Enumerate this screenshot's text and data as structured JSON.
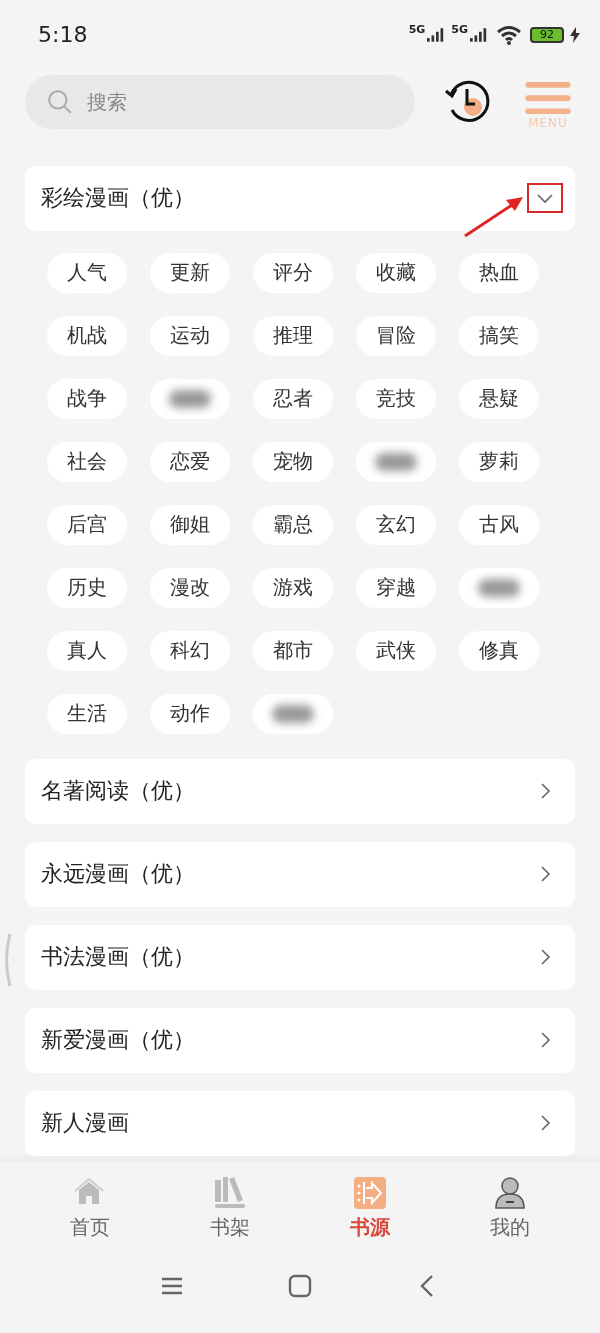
{
  "status_bar": {
    "time": "5:18",
    "networks": [
      "5G",
      "5G"
    ],
    "battery": "92",
    "charging": true
  },
  "search": {
    "placeholder": "搜索"
  },
  "menu_label": "MENU",
  "sources": [
    {
      "name": "彩绘漫画（优）",
      "expanded": true,
      "highlighted": true,
      "tags": [
        {
          "kind": "text",
          "text": "人气"
        },
        {
          "kind": "text",
          "text": "更新"
        },
        {
          "kind": "text",
          "text": "评分"
        },
        {
          "kind": "text",
          "text": "收藏"
        },
        {
          "kind": "text",
          "text": "热血"
        },
        {
          "kind": "text",
          "text": "机战"
        },
        {
          "kind": "text",
          "text": "运动"
        },
        {
          "kind": "text",
          "text": "推理"
        },
        {
          "kind": "text",
          "text": "冒险"
        },
        {
          "kind": "text",
          "text": "搞笑"
        },
        {
          "kind": "text",
          "text": "战争"
        },
        {
          "kind": "blurred"
        },
        {
          "kind": "text",
          "text": "忍者"
        },
        {
          "kind": "text",
          "text": "竞技"
        },
        {
          "kind": "text",
          "text": "悬疑"
        },
        {
          "kind": "text",
          "text": "社会"
        },
        {
          "kind": "text",
          "text": "恋爱"
        },
        {
          "kind": "text",
          "text": "宠物"
        },
        {
          "kind": "blurred"
        },
        {
          "kind": "text",
          "text": "萝莉"
        },
        {
          "kind": "text",
          "text": "后宫"
        },
        {
          "kind": "text",
          "text": "御姐"
        },
        {
          "kind": "text",
          "text": "霸总"
        },
        {
          "kind": "text",
          "text": "玄幻"
        },
        {
          "kind": "text",
          "text": "古风"
        },
        {
          "kind": "text",
          "text": "历史"
        },
        {
          "kind": "text",
          "text": "漫改"
        },
        {
          "kind": "text",
          "text": "游戏"
        },
        {
          "kind": "text",
          "text": "穿越"
        },
        {
          "kind": "blurred"
        },
        {
          "kind": "text",
          "text": "真人"
        },
        {
          "kind": "text",
          "text": "科幻"
        },
        {
          "kind": "text",
          "text": "都市"
        },
        {
          "kind": "text",
          "text": "武侠"
        },
        {
          "kind": "text",
          "text": "修真"
        },
        {
          "kind": "text",
          "text": "生活"
        },
        {
          "kind": "text",
          "text": "动作"
        },
        {
          "kind": "blurred"
        }
      ]
    },
    {
      "name": "名著阅读（优）",
      "expanded": false,
      "highlighted": false
    },
    {
      "name": "永远漫画（优）",
      "expanded": false,
      "highlighted": false
    },
    {
      "name": "书法漫画（优）",
      "expanded": false,
      "highlighted": false
    },
    {
      "name": "新爱漫画（优）",
      "expanded": false,
      "highlighted": false
    },
    {
      "name": "新人漫画",
      "expanded": false,
      "highlighted": false
    }
  ],
  "bottom_nav": [
    {
      "label": "首页",
      "selected": false
    },
    {
      "label": "书架",
      "selected": false
    },
    {
      "label": "书源",
      "selected": true
    },
    {
      "label": "我的",
      "selected": false
    }
  ]
}
